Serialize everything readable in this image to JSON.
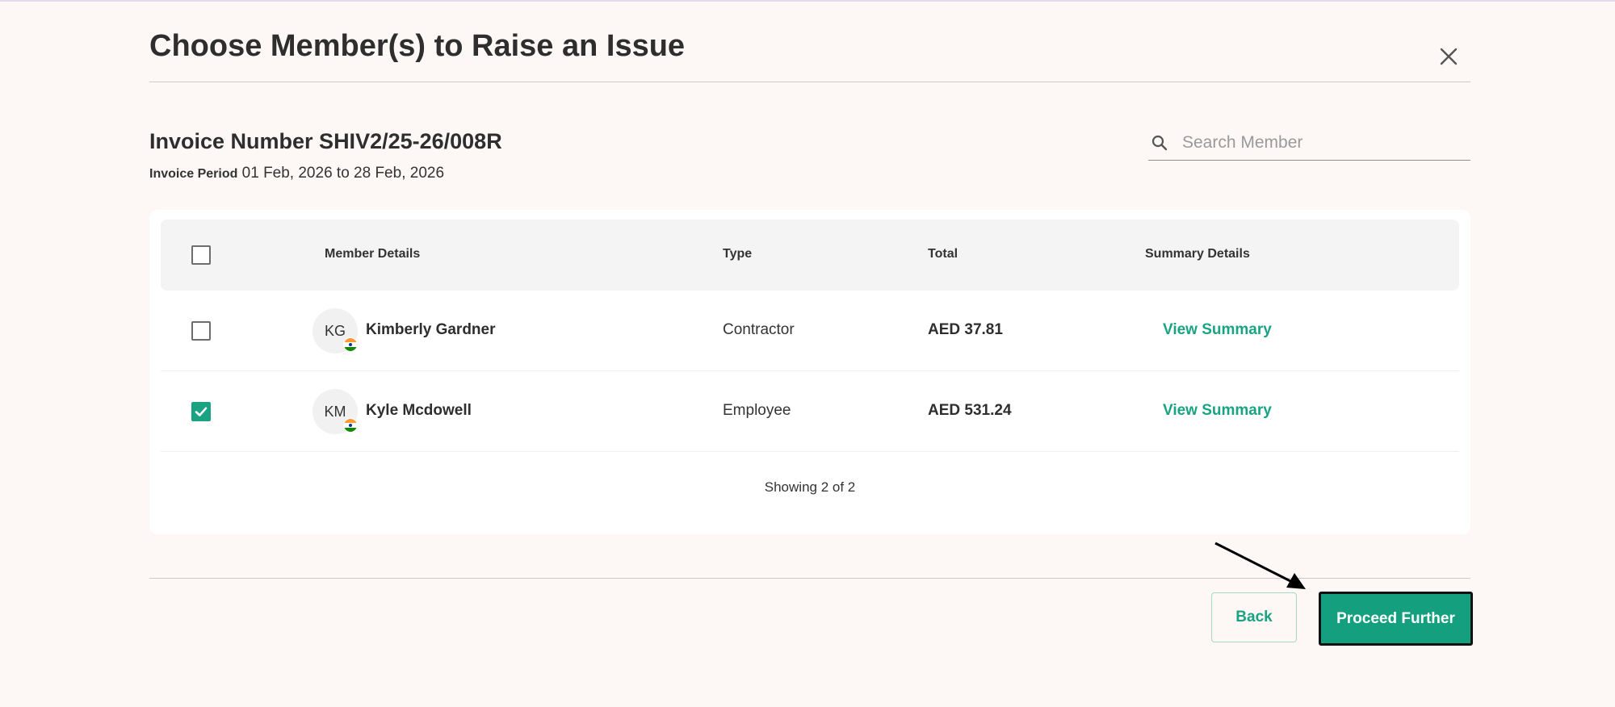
{
  "modal": {
    "title": "Choose Member(s) to Raise an Issue"
  },
  "invoice": {
    "number_label": "Invoice Number SHIV2/25-26/008R",
    "period_label": "Invoice Period",
    "period_value": "01 Feb, 2026 to 28 Feb, 2026"
  },
  "search": {
    "placeholder": "Search Member"
  },
  "table": {
    "headers": {
      "member": "Member Details",
      "type": "Type",
      "total": "Total",
      "summary": "Summary Details"
    },
    "select_all_checked": false,
    "rows": [
      {
        "initials": "KG",
        "name": "Kimberly Gardner",
        "type": "Contractor",
        "total": "AED 37.81",
        "summary_link": "View Summary",
        "checked": false,
        "flag": "india-flag-icon"
      },
      {
        "initials": "KM",
        "name": "Kyle Mcdowell",
        "type": "Employee",
        "total": "AED 531.24",
        "summary_link": "View Summary",
        "checked": true,
        "flag": "india-flag-icon"
      }
    ],
    "pagination": "Showing 2 of 2"
  },
  "footer": {
    "back_label": "Back",
    "proceed_label": "Proceed Further"
  },
  "colors": {
    "accent": "#1aa383",
    "background": "#fdf7f6"
  }
}
